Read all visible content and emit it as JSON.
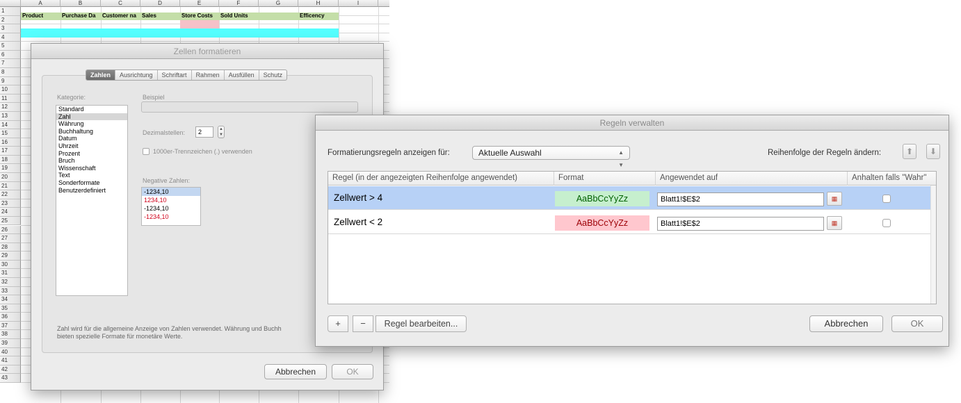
{
  "sheet": {
    "columns": [
      "A",
      "B",
      "C",
      "D",
      "E",
      "F",
      "G",
      "H",
      "I"
    ],
    "rows": [
      "1",
      "2",
      "3",
      "4",
      "5",
      "6",
      "7",
      "8",
      "9",
      "10",
      "11",
      "12",
      "13",
      "14",
      "15",
      "16",
      "17",
      "18",
      "19",
      "20",
      "21",
      "22",
      "23",
      "24",
      "25",
      "26",
      "27",
      "28",
      "29",
      "30",
      "31",
      "32",
      "33",
      "34",
      "35",
      "36",
      "37",
      "38",
      "39",
      "40",
      "41",
      "42",
      "43"
    ],
    "header_row": {
      "a": "Product",
      "b": "Purchase Da",
      "c": "Customer na",
      "d": "Sales",
      "e": "Store Costs",
      "f": "Sold Units",
      "h": "Efficency"
    },
    "colors": {
      "header_fill": "#c4dea8",
      "row3_fill": "#55ffff",
      "e2_fill": "#f5c1c8"
    }
  },
  "zellen_dialog": {
    "title": "Zellen formatieren",
    "tabs": [
      "Zahlen",
      "Ausrichtung",
      "Schriftart",
      "Rahmen",
      "Ausfüllen",
      "Schutz"
    ],
    "active_tab": "Zahlen",
    "kategorie_label": "Kategorie:",
    "categories": [
      "Standard",
      "Zahl",
      "Währung",
      "Buchhaltung",
      "Datum",
      "Uhrzeit",
      "Prozent",
      "Bruch",
      "Wissenschaft",
      "Text",
      "Sonderformate",
      "Benutzerdefiniert"
    ],
    "selected_category": "Zahl",
    "beispiel_label": "Beispiel",
    "dezimal_label": "Dezimalstellen:",
    "dezimal_value": "2",
    "trenn_label": "1000er-Trennzeichen (.) verwenden",
    "negative_label": "Negative Zahlen:",
    "negative_options": [
      {
        "text": "-1234,10",
        "style": "selected"
      },
      {
        "text": "1234,10",
        "style": "red"
      },
      {
        "text": "-1234,10",
        "style": "normal"
      },
      {
        "text": "-1234,10",
        "style": "red"
      }
    ],
    "description_line1": "Zahl wird für die allgemeine Anzeige von Zahlen verwendet. Währung und Buchh",
    "description_line2": "bieten spezielle Formate für monetäre Werte.",
    "cancel_label": "Abbrechen",
    "ok_label": "OK"
  },
  "regeln_dialog": {
    "title": "Regeln verwalten",
    "show_rules_label": "Formatierungsregeln anzeigen für:",
    "show_rules_value": "Aktuelle Auswahl",
    "order_label": "Reihenfolge der Regeln ändern:",
    "columns": {
      "rule": "Regel (in der angezeigten Reihenfolge angewendet)",
      "format": "Format",
      "applied": "Angewendet auf",
      "stop": "Anhalten falls \"Wahr\""
    },
    "rules": [
      {
        "rule": "Zellwert > 4",
        "format": "AaBbCcYyZz",
        "applied": "Blatt1!$E$2",
        "selected": true
      },
      {
        "rule": "Zellwert < 2",
        "format": "AaBbCcYyZz",
        "applied": "Blatt1!$E$2",
        "selected": false
      }
    ],
    "add_label": "+",
    "remove_label": "−",
    "edit_label": "Regel bearbeiten...",
    "cancel_label": "Abbrechen",
    "ok_label": "OK"
  }
}
